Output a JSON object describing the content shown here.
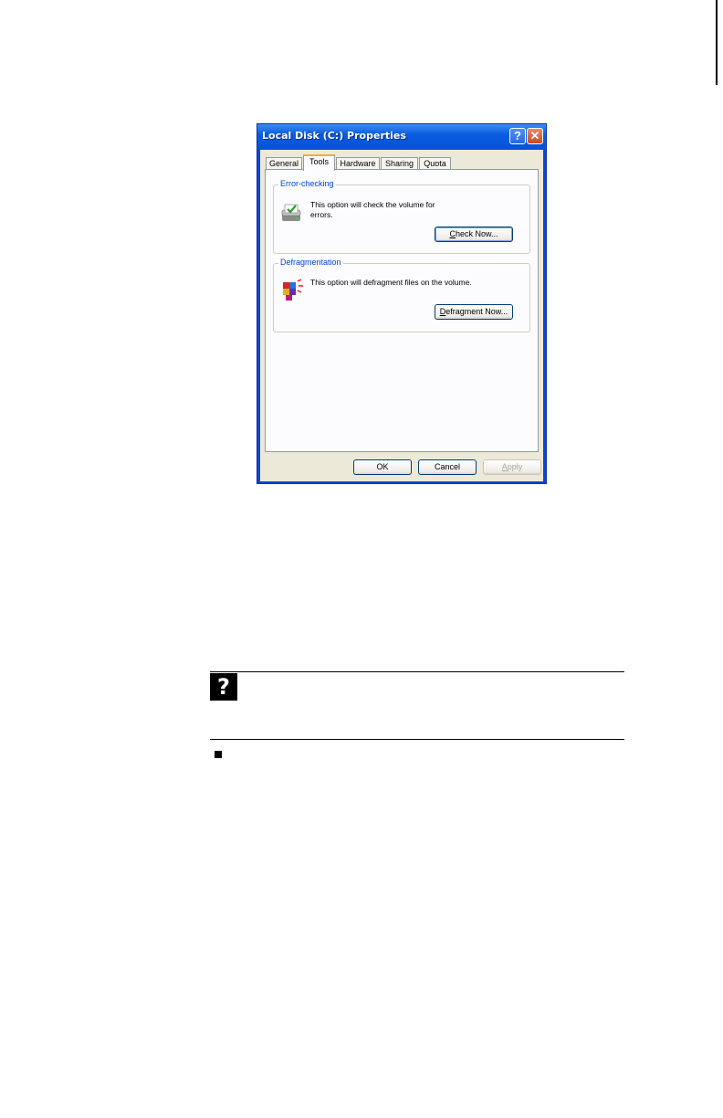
{
  "dialog": {
    "title": "Local Disk (C:) Properties",
    "help_label": "?",
    "close_label": "✕",
    "tabs": [
      {
        "label": "General"
      },
      {
        "label": "Tools"
      },
      {
        "label": "Hardware"
      },
      {
        "label": "Sharing"
      },
      {
        "label": "Quota"
      }
    ],
    "error_checking": {
      "title": "Error-checking",
      "text": "This option will check the volume for errors.",
      "button_first": "C",
      "button_rest": "heck Now..."
    },
    "defragmentation": {
      "title": "Defragmentation",
      "text": "This option will defragment files on the volume.",
      "button_first": "D",
      "button_rest": "efragment Now..."
    },
    "ok_label": "OK",
    "cancel_label": "Cancel",
    "apply_first": "A",
    "apply_rest": "pply"
  },
  "note": {
    "icon_label": "?"
  }
}
